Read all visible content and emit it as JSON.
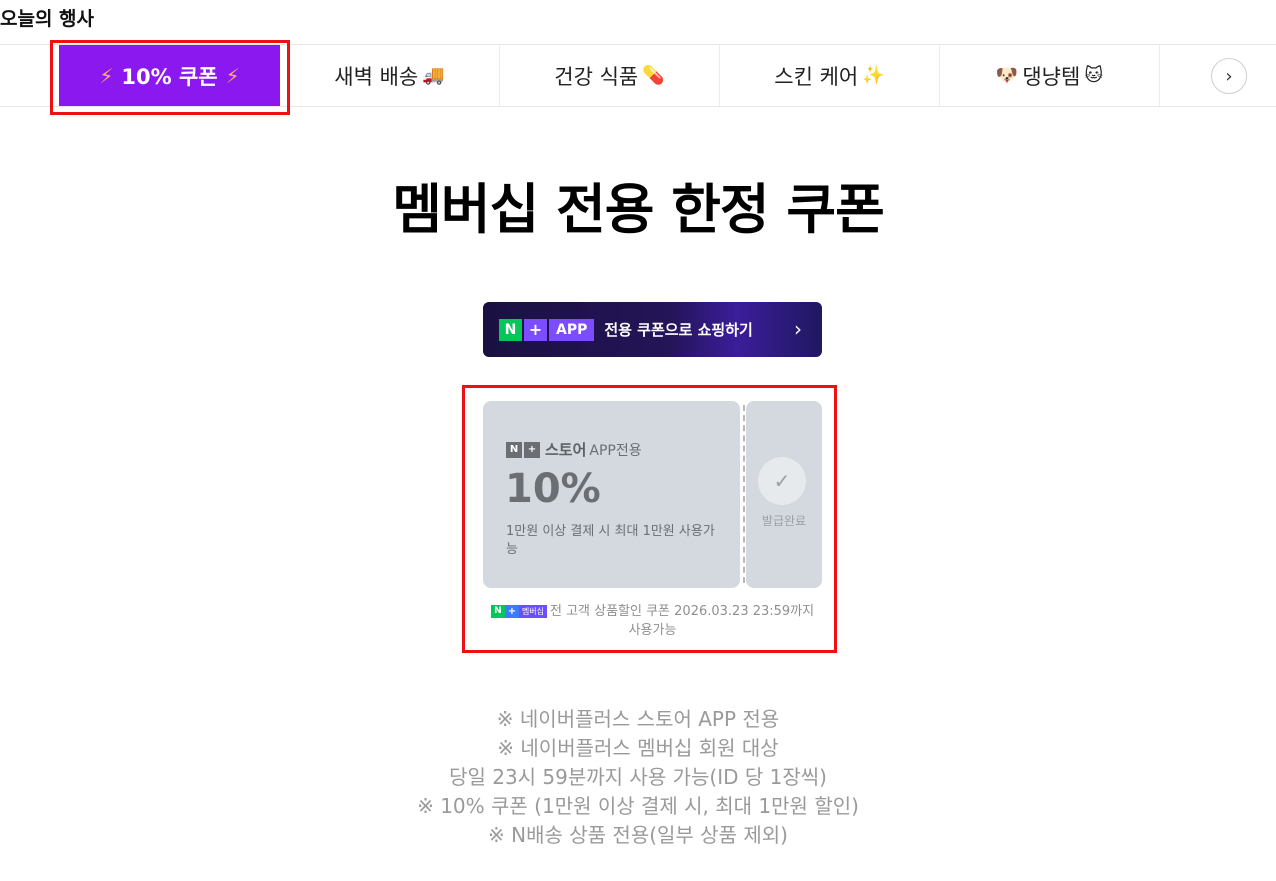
{
  "page_header": "오늘의 행사",
  "tabs": [
    {
      "label": "10% 쿠폰",
      "emoji": ""
    },
    {
      "label": "새벽 배송",
      "emoji": "🚚"
    },
    {
      "label": "건강 식품",
      "emoji": "💊"
    },
    {
      "label": "스킨 케어",
      "emoji": "✨"
    },
    {
      "label": "댕냥템",
      "emoji": "🐱",
      "prefix_emoji": "🐶"
    }
  ],
  "tab_icons": {
    "active_tab_icon": "⚡",
    "next_button_icon": "›"
  },
  "main_title": "멤버십 전용 한정 쿠폰",
  "promo_banner": {
    "n_badge": "N",
    "plus_badge": "+",
    "app_badge": "APP",
    "text": "전용 쿠폰으로 쇼핑하기",
    "chevron": "›"
  },
  "coupon": {
    "n_badge": "N",
    "plus_badge": "+",
    "brand": "스토어",
    "brand_sub": "APP전용",
    "amount": "10%",
    "condition": "1만원 이상 결제 시 최대 1만원 사용가능",
    "check_icon": "✓",
    "status": "발급완료"
  },
  "coupon_note": {
    "n_badge": "N",
    "plus_badge": "+",
    "membership_badge": "멤버십",
    "text": "전 고객 상품할인 쿠폰 2026.03.23 23:59까지 사용가능"
  },
  "notes": [
    "※ 네이버플러스 스토어 APP 전용",
    "※ 네이버플러스 멤버십 회원 대상",
    "당일 23시 59분까지 사용 가능(ID 당 1장씩)",
    "※ 10% 쿠폰 (1만원 이상 결제 시, 최대 1만원 할인)",
    "※ N배송 상품 전용(일부 상품 제외)"
  ],
  "colors": {
    "active_tab_bg": "#8c18f0",
    "highlight_box": "#ee1111",
    "naver_green": "#03c75a",
    "coupon_bg": "#d3d9de"
  }
}
